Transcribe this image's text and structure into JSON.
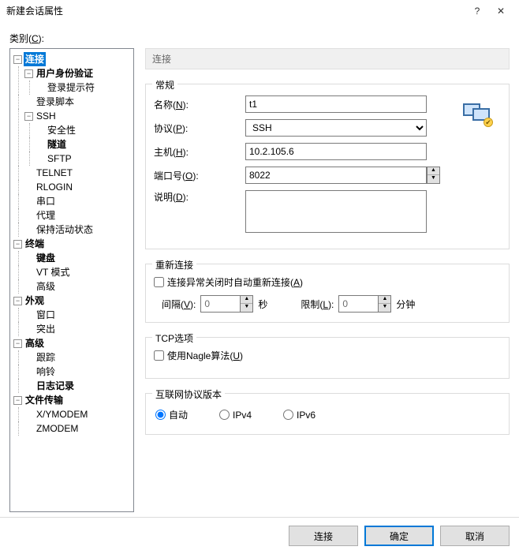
{
  "title": "新建会话属性",
  "help_icon": "?",
  "close_icon": "✕",
  "category_label": "类别(C):",
  "tree": {
    "connection": "连接",
    "auth": "用户身份验证",
    "login_prompt": "登录提示符",
    "login_script": "登录脚本",
    "ssh": "SSH",
    "security": "安全性",
    "tunnel": "隧道",
    "sftp": "SFTP",
    "telnet": "TELNET",
    "rlogin": "RLOGIN",
    "serial": "串口",
    "proxy": "代理",
    "keepalive": "保持活动状态",
    "terminal": "终端",
    "keyboard": "键盘",
    "vt": "VT 模式",
    "advanced_t": "高级",
    "appearance": "外观",
    "window": "窗口",
    "highlight": "突出",
    "advanced": "高级",
    "trace": "跟踪",
    "bell": "响铃",
    "logging": "日志记录",
    "filetransfer": "文件传输",
    "xymodem": "X/YMODEM",
    "zmodem": "ZMODEM"
  },
  "panel": {
    "heading": "连接",
    "general": {
      "legend": "常规",
      "name_label": "名称(N):",
      "name_value": "t1",
      "protocol_label": "协议(P):",
      "protocol_value": "SSH",
      "host_label": "主机(H):",
      "host_value": "10.2.105.6",
      "port_label": "端口号(O):",
      "port_value": "8022",
      "desc_label": "说明(D):",
      "desc_value": ""
    },
    "reconnect": {
      "legend": "重新连接",
      "checkbox_label": "连接异常关闭时自动重新连接(A)",
      "interval_label": "间隔(V):",
      "interval_value": "0",
      "interval_unit": "秒",
      "limit_label": "限制(L):",
      "limit_value": "0",
      "limit_unit": "分钟"
    },
    "tcp": {
      "legend": "TCP选项",
      "nagle_label": "使用Nagle算法(U)"
    },
    "ipver": {
      "legend": "互联网协议版本",
      "auto": "自动",
      "ipv4": "IPv4",
      "ipv6": "IPv6"
    }
  },
  "footer": {
    "connect": "连接",
    "ok": "确定",
    "cancel": "取消"
  }
}
